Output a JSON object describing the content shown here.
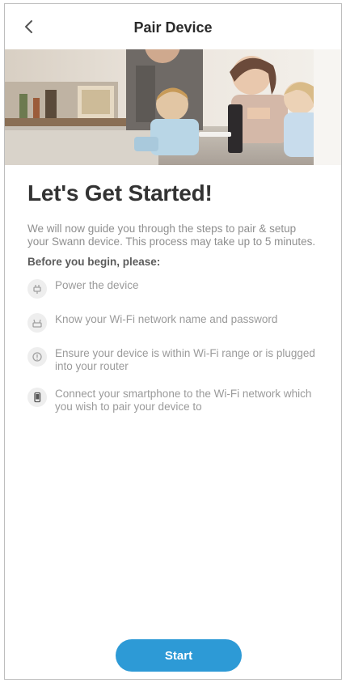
{
  "header": {
    "title": "Pair Device",
    "back_icon": "chevron-left-icon"
  },
  "hero": {
    "image": "family-photo"
  },
  "main": {
    "headline": "Let's Get Started!",
    "intro": "We will now guide you through the steps to pair & setup your Swann device. This process may take up to 5 minutes.",
    "before_label": "Before you begin, please:",
    "checklist": [
      {
        "icon": "power-plug-icon",
        "text": "Power the device"
      },
      {
        "icon": "wifi-router-icon",
        "text": "Know your Wi-Fi network name and password"
      },
      {
        "icon": "wifi-range-icon",
        "text": "Ensure your device is within Wi-Fi range or is plugged into your router"
      },
      {
        "icon": "smartphone-icon",
        "text": "Connect your smartphone to the Wi-Fi network which you wish to pair your device to"
      }
    ]
  },
  "footer": {
    "start_label": "Start"
  },
  "colors": {
    "accent": "#2d9ad6",
    "title": "#2b2b2b",
    "body_text": "#9a9a9a"
  }
}
